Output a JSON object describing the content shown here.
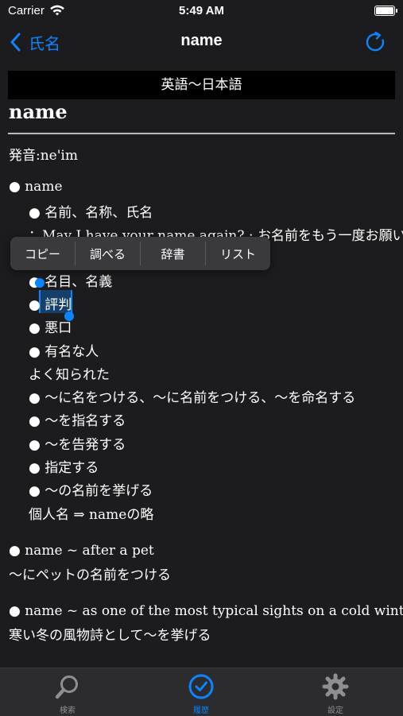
{
  "status_bar": {
    "carrier": "Carrier",
    "time": "5:49 AM"
  },
  "nav": {
    "back_label": "氏名",
    "title": "name"
  },
  "entry": {
    "header": "英語～日本語",
    "headword": "name",
    "pronunciation": "発音:ne'im",
    "lines": [
      "● name",
      "● 名前、名称、氏名",
      "：May I have your name again? : お名前をもう一度お願い",
      "● 名目、名義",
      "● 評判",
      "● 悪口",
      "● 有名な人",
      "よく知られた",
      "● ～に名をつける、～に名前をつける、～を命名する",
      "● ～を指名する",
      "● ～を告発する",
      "● 指定する",
      "● ～の名前を挙げる",
      "個人名 ⇒ nameの略",
      "● name ~ after a pet",
      "～にペットの名前をつける",
      "● name ~ as one of the most typical sights on a cold winter's day",
      "寒い冬の風物詩として～を挙げる"
    ]
  },
  "context_menu": [
    "コピー",
    "調べる",
    "辞書",
    "リスト"
  ],
  "tabs": [
    {
      "label": "検索",
      "icon": "search-icon"
    },
    {
      "label": "履歴",
      "icon": "history-icon"
    },
    {
      "label": "設定",
      "icon": "gear-icon"
    }
  ],
  "colors": {
    "accent": "#0a84ff",
    "background": "#1c1c1e",
    "tab_inactive": "#8e8e93"
  }
}
